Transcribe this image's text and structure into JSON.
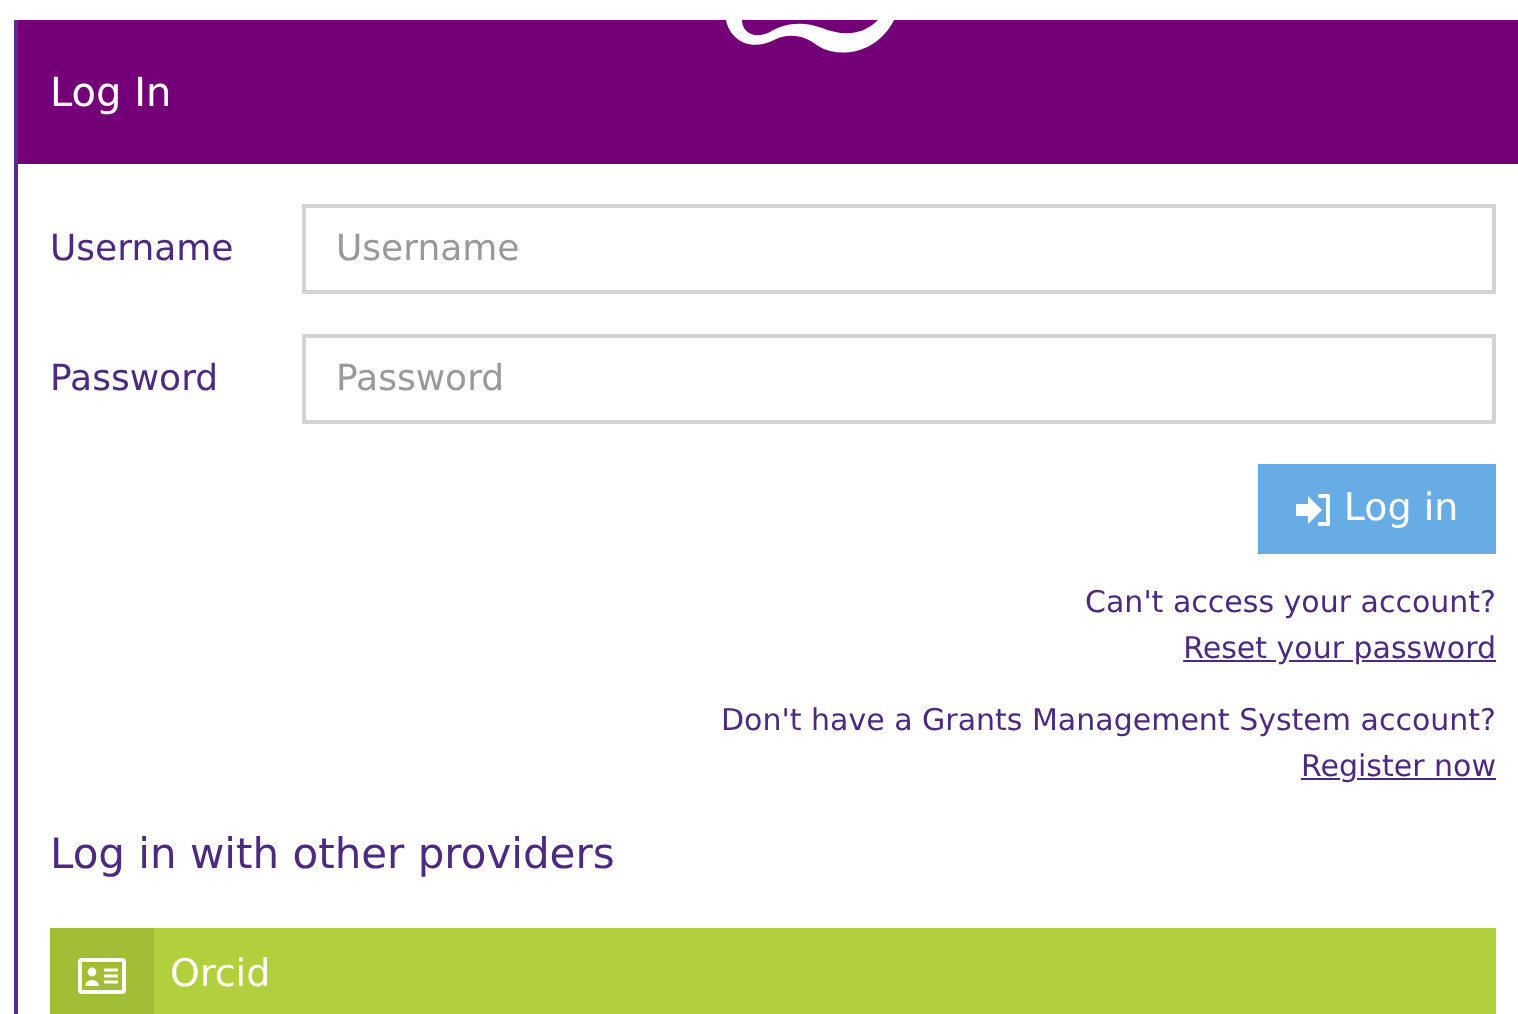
{
  "panel": {
    "title": "Log In"
  },
  "fields": [
    {
      "label": "Username",
      "placeholder": "Username"
    },
    {
      "label": "Password",
      "placeholder": "Password"
    }
  ],
  "login_button": {
    "label": "Log in"
  },
  "help_links": [
    {
      "text": "Can't access your account?",
      "link": "Reset your password"
    },
    {
      "text": "Don't have a Grants Management System account?",
      "link": "Register now"
    }
  ],
  "providers": {
    "heading": "Log in with other providers",
    "items": [
      {
        "label": "Orcid"
      }
    ]
  }
}
